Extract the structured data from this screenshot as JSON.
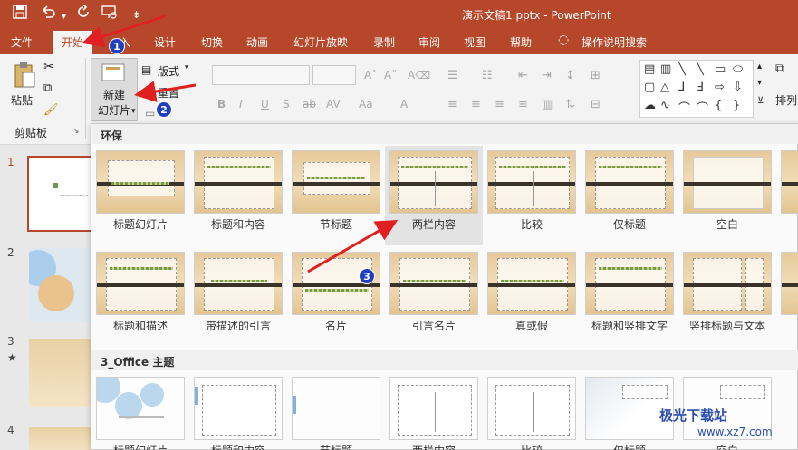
{
  "title_bar": {
    "doc_title": "演示文稿1.pptx  -  PowerPoint",
    "quick_access": [
      "save-icon",
      "undo-icon",
      "redo-icon",
      "present-icon",
      "customize-icon"
    ]
  },
  "tabs": [
    "文件",
    "开始",
    "插入",
    "设计",
    "切换",
    "动画",
    "幻灯片放映",
    "录制",
    "审阅",
    "视图",
    "帮助",
    "操作说明搜索"
  ],
  "tab_insert_visible": "入",
  "ribbon": {
    "paste_label": "粘贴",
    "clipboard_group": "剪贴板",
    "new_slide_label_line1": "新建",
    "new_slide_label_line2": "幻灯片",
    "layout_label": "版式",
    "reset_label": "重置",
    "arrange_label": "排列",
    "font_buttons": [
      "B",
      "I",
      "U",
      "S",
      "ab",
      "AV",
      "Aa",
      "A"
    ]
  },
  "slide_numbers": [
    "1",
    "2",
    "3",
    "4"
  ],
  "slide3_marker": "★",
  "slide1_thumb_text": "A Sustainable Planet",
  "sections": [
    {
      "name": "环保",
      "rows": [
        [
          "标题幻灯片",
          "标题和内容",
          "节标题",
          "两栏内容",
          "比较",
          "仅标题",
          "空白"
        ],
        [
          "标题和描述",
          "带描述的引言",
          "名片",
          "引言名片",
          "真或假",
          "标题和竖排文字",
          "竖排标题与文本"
        ]
      ]
    },
    {
      "name": "3_Office 主题",
      "rows": [
        [
          "标题幻灯片",
          "标题和内容",
          "节标题",
          "两栏内容",
          "比较",
          "仅标题",
          "空白"
        ]
      ]
    }
  ],
  "annotations": [
    "1",
    "2",
    "3"
  ],
  "watermark": {
    "text": "极光下载站",
    "url": "www.xz7.com"
  },
  "colors": {
    "brand": "#b7472a",
    "annotation_arrow": "#e02020",
    "badge": "#1f3fbf"
  }
}
